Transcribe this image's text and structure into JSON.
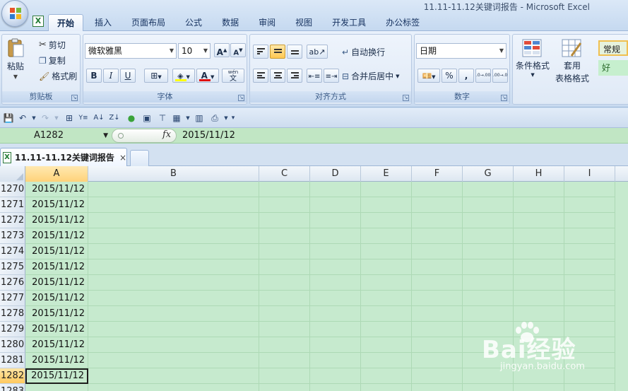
{
  "window": {
    "title": "11.11-11.12关键词报告 - Microsoft Excel",
    "app_icon": "excel-icon"
  },
  "ribbon_tabs": [
    "开始",
    "插入",
    "页面布局",
    "公式",
    "数据",
    "审阅",
    "视图",
    "开发工具",
    "办公标签"
  ],
  "active_ribbon_tab": "开始",
  "clipboard": {
    "paste_label": "粘贴",
    "cut_label": "剪切",
    "copy_label": "复制",
    "format_painter_label": "格式刷",
    "group_label": "剪贴板"
  },
  "font": {
    "name": "微软雅黑",
    "size": "10",
    "increase_label": "A",
    "decrease_label": "A",
    "bold": "B",
    "italic": "I",
    "underline": "U",
    "font_color_label": "A",
    "phonetic_label": "wén",
    "phonetic_char": "文",
    "group_label": "字体"
  },
  "alignment": {
    "wrap_text_label": "自动换行",
    "merge_label": "合并后居中",
    "group_label": "对齐方式"
  },
  "number": {
    "format": "日期",
    "percent": "%",
    "comma": ",",
    "increase_decimal": ".0→.00",
    "decrease_decimal": ".00→.0",
    "group_label": "数字"
  },
  "styles": {
    "conditional_label": "条件格式",
    "format_as_table_label1": "套用",
    "format_as_table_label2": "表格格式",
    "normal_label": "常规",
    "good_label": "好"
  },
  "formula_bar": {
    "name_box": "A1282",
    "fx_label": "fx",
    "value": "2015/11/12"
  },
  "workbook_tab": {
    "name": "11.11-11.12关键词报告",
    "close": "×"
  },
  "columns": [
    "A",
    "B",
    "C",
    "D",
    "E",
    "F",
    "G",
    "H",
    "I"
  ],
  "selected_column": "A",
  "rows": [
    {
      "num": "1270",
      "a": "2015/11/12"
    },
    {
      "num": "1271",
      "a": "2015/11/12"
    },
    {
      "num": "1272",
      "a": "2015/11/12"
    },
    {
      "num": "1273",
      "a": "2015/11/12"
    },
    {
      "num": "1274",
      "a": "2015/11/12"
    },
    {
      "num": "1275",
      "a": "2015/11/12"
    },
    {
      "num": "1276",
      "a": "2015/11/12"
    },
    {
      "num": "1277",
      "a": "2015/11/12"
    },
    {
      "num": "1278",
      "a": "2015/11/12"
    },
    {
      "num": "1279",
      "a": "2015/11/12"
    },
    {
      "num": "1280",
      "a": "2015/11/12"
    },
    {
      "num": "1281",
      "a": "2015/11/12"
    },
    {
      "num": "1282",
      "a": "2015/11/12"
    },
    {
      "num": "1283",
      "a": ""
    }
  ],
  "active_row": "1282",
  "watermark": {
    "main": "Bai经验",
    "du": "du",
    "sub": "jingyan.baidu.com"
  },
  "colors": {
    "sheet_green": "#c6eace",
    "selection_orange": "#ffc95e",
    "ribbon_blue": "#d5e3f4"
  }
}
